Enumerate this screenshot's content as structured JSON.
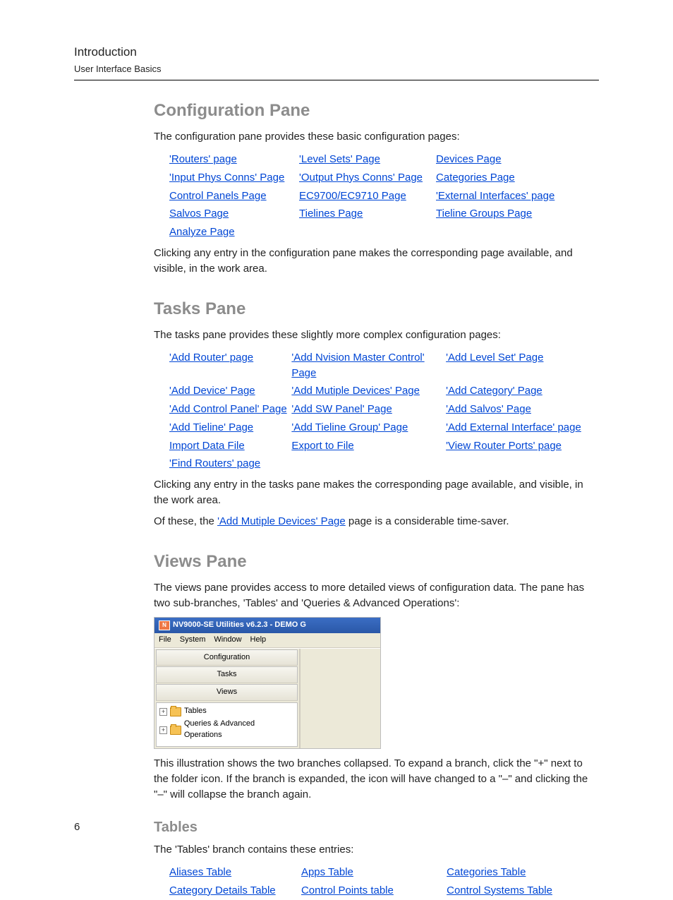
{
  "header": {
    "title": "Introduction",
    "subtitle": "User Interface Basics"
  },
  "page_number": "6",
  "sections": {
    "config": {
      "heading": "Configuration Pane",
      "intro": "The configuration pane provides these basic configuration pages:",
      "links": [
        [
          "'Routers' page",
          "'Level Sets' Page",
          "Devices Page"
        ],
        [
          "'Input Phys Conns' Page",
          "'Output Phys Conns' Page",
          "Categories Page"
        ],
        [
          "Control Panels Page",
          "EC9700/EC9710 Page",
          "'External Interfaces' page"
        ],
        [
          "Salvos Page",
          "Tielines Page",
          "Tieline Groups Page"
        ],
        [
          "Analyze Page",
          "",
          ""
        ]
      ],
      "outro": "Clicking any entry in the configuration pane makes the corresponding page available, and visible, in the work area."
    },
    "tasks": {
      "heading": "Tasks Pane",
      "intro": "The tasks pane provides these slightly more complex configuration pages:",
      "links": [
        [
          "'Add Router' page",
          "'Add Nvision Master Control' Page",
          "'Add Level Set' Page"
        ],
        [
          "'Add Device' Page",
          "'Add Mutiple Devices' Page",
          "'Add Category' Page"
        ],
        [
          "'Add Control Panel' Page",
          "'Add SW Panel' Page",
          "'Add Salvos' Page"
        ],
        [
          "'Add Tieline' Page",
          "'Add Tieline Group' Page",
          "'Add External Interface' page"
        ],
        [
          "Import Data File",
          "Export to File",
          "'View Router Ports' page"
        ],
        [
          "'Find Routers' page",
          "",
          ""
        ]
      ],
      "outro1": "Clicking any entry in the tasks pane makes the corresponding page available, and visible, in the work area.",
      "outro2_pre": "Of these, the ",
      "outro2_link": "'Add Mutiple Devices' Page",
      "outro2_post": " page is a considerable time-saver."
    },
    "views": {
      "heading": "Views Pane",
      "intro": "The views pane provides access to more detailed views of configuration data. The pane has two sub-branches, 'Tables' and 'Queries & Advanced Operations':",
      "screenshot": {
        "title": "NV9000-SE Utilities v6.2.3 - DEMO G",
        "menu": [
          "File",
          "System",
          "Window",
          "Help"
        ],
        "tabs": [
          "Configuration",
          "Tasks",
          "Views"
        ],
        "tree": [
          "Tables",
          "Queries & Advanced Operations"
        ]
      },
      "outro": "This illustration shows the two branches collapsed. To expand a branch, click the \"+\" next to the folder icon. If the branch is expanded, the icon will have changed to a \"–\" and clicking the \"–\" will collapse the branch again."
    },
    "tables": {
      "heading": "Tables",
      "intro": "The 'Tables' branch contains these entries:",
      "links": [
        [
          "Aliases Table",
          "Apps Table",
          "Categories Table"
        ],
        [
          "Category Details Table",
          "Control Points table",
          "Control Systems Table"
        ]
      ]
    }
  }
}
